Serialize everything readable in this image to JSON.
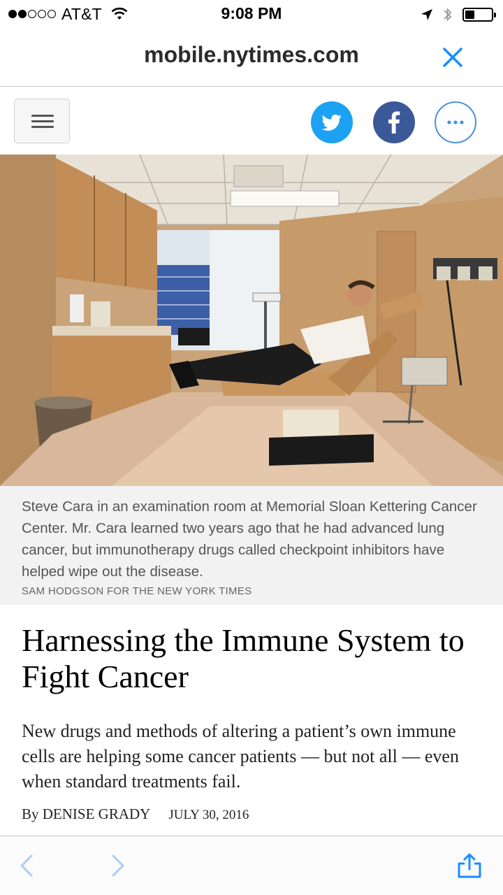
{
  "status_bar": {
    "carrier": "AT&T",
    "time": "9:08 PM",
    "battery_level": 0.35,
    "signal_bars_filled": 2,
    "signal_bars_total": 5
  },
  "browser": {
    "url": "mobile.nytimes.com",
    "accent_color": "#1a8cff"
  },
  "share": {
    "twitter_icon": "twitter-icon",
    "facebook_icon": "facebook-icon",
    "more_icon": "more-icon",
    "twitter_color": "#1da1f2",
    "facebook_color": "#3b5998"
  },
  "article": {
    "caption": "Steve Cara in an examination room at Memorial Sloan Kettering Cancer Center. Mr. Cara learned two years ago that he had advanced lung cancer, but immunotherapy drugs called checkpoint inhibitors have helped wipe out the disease.",
    "photo_credit": "SAM HODGSON FOR THE NEW YORK TIMES",
    "headline": "Harnessing the Immune System to Fight Cancer",
    "summary": "New drugs and methods of altering a patient’s own immune cells are helping some cancer patients — but not all — even when standard treatments fail.",
    "byline": "By DENISE GRADY",
    "date": "JULY 30, 2016"
  },
  "toolbar": {
    "back_icon": "back-icon",
    "forward_icon": "forward-icon",
    "share_icon": "share-icon"
  }
}
